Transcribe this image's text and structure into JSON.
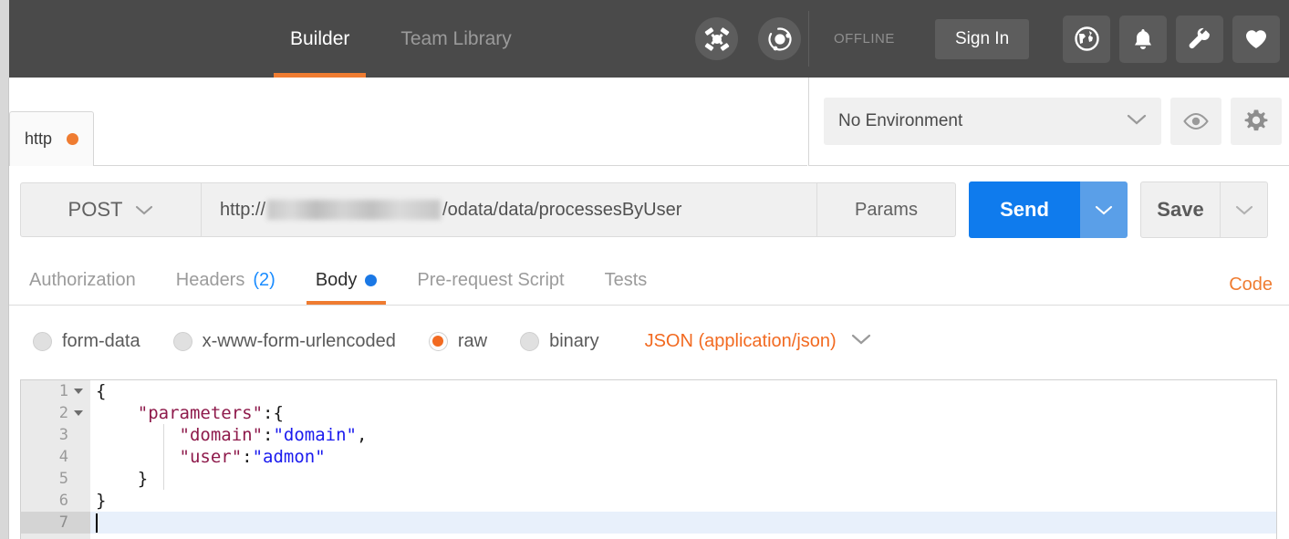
{
  "app": {
    "header": {
      "nav_tabs": [
        {
          "label": "Builder",
          "active": true
        },
        {
          "label": "Team Library",
          "active": false
        }
      ],
      "interceptor_icon": "interceptor-icon",
      "sync_icon": "sync-icon",
      "status": "OFFLINE",
      "sign_in_label": "Sign In",
      "right_icons": [
        {
          "name": "globe-icon"
        },
        {
          "name": "bell-icon"
        },
        {
          "name": "wrench-icon"
        },
        {
          "name": "heart-icon"
        }
      ]
    },
    "request_tabs": [
      {
        "label": "http",
        "unsaved": true
      }
    ],
    "environment": {
      "selected": "No Environment",
      "eye_icon": "eye-icon",
      "gear_icon": "gear-icon"
    },
    "url_bar": {
      "method": "POST",
      "url_prefix": "http://",
      "url_host_redacted": true,
      "url_path": "/odata/data/processesByUser",
      "url_full": "http:///odata/data/processesByUser",
      "params_label": "Params",
      "send_label": "Send",
      "save_label": "Save"
    },
    "req_tabs": [
      {
        "label": "Authorization",
        "active": false,
        "count": "",
        "dot": false
      },
      {
        "label": "Headers",
        "active": false,
        "count": "(2)",
        "dot": false
      },
      {
        "label": "Body",
        "active": true,
        "count": "",
        "dot": true
      },
      {
        "label": "Pre-request Script",
        "active": false,
        "count": "",
        "dot": false
      },
      {
        "label": "Tests",
        "active": false,
        "count": "",
        "dot": false
      }
    ],
    "code_link": "Code",
    "body_types": [
      {
        "label": "form-data",
        "selected": false
      },
      {
        "label": "x-www-form-urlencoded",
        "selected": false
      },
      {
        "label": "raw",
        "selected": true
      },
      {
        "label": "binary",
        "selected": false
      }
    ],
    "content_type": "JSON (application/json)",
    "editor": {
      "lines": [
        {
          "num": "1",
          "foldable": true,
          "active": false,
          "text": "{"
        },
        {
          "num": "2",
          "foldable": true,
          "active": false,
          "text": "    \"parameters\":{"
        },
        {
          "num": "3",
          "foldable": false,
          "active": false,
          "text": "        \"domain\":\"domain\","
        },
        {
          "num": "4",
          "foldable": false,
          "active": false,
          "text": "        \"user\":\"admon\""
        },
        {
          "num": "5",
          "foldable": false,
          "active": false,
          "text": "    }"
        },
        {
          "num": "6",
          "foldable": false,
          "active": false,
          "text": "}"
        },
        {
          "num": "7",
          "foldable": false,
          "active": true,
          "text": ""
        }
      ],
      "raw_body": "{\n    \"parameters\":{\n        \"domain\":\"domain\",\n        \"user\":\"admon\"\n    }\n}\n"
    },
    "colors": {
      "header_bg": "#4a4a4a",
      "accent_orange": "#ef7c31",
      "send_blue": "#0f7bed",
      "tab_count_blue": "#1a8cff",
      "key_maroon": "#8e1a4b",
      "string_blue": "#1a1aee",
      "active_line_bg": "#e8f0fb"
    }
  }
}
